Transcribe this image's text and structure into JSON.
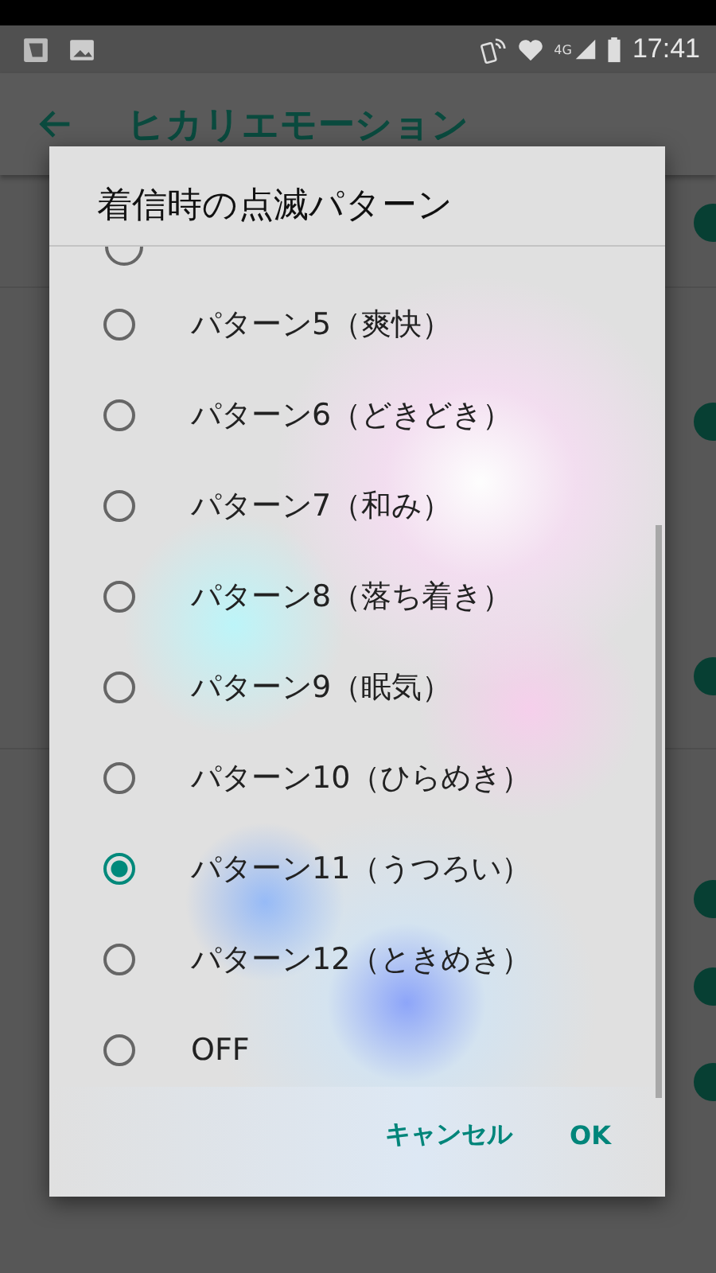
{
  "status_bar": {
    "network_type": "4G",
    "time": "17:41"
  },
  "app_bar": {
    "title": "ヒカリエモーション"
  },
  "background_toggles": [
    {
      "on": true
    },
    {
      "on": true
    },
    {
      "on": true
    },
    {
      "on": true
    },
    {
      "on": true
    },
    {
      "on": true
    }
  ],
  "dialog": {
    "title": "着信時の点滅パターン",
    "cut_option": {
      "selected": false
    },
    "options": [
      {
        "label": "パターン5（爽快）",
        "selected": false
      },
      {
        "label": "パターン6（どきどき）",
        "selected": false
      },
      {
        "label": "パターン7（和み）",
        "selected": false
      },
      {
        "label": "パターン8（落ち着き）",
        "selected": false
      },
      {
        "label": "パターン9（眠気）",
        "selected": false
      },
      {
        "label": "パターン10（ひらめき）",
        "selected": false
      },
      {
        "label": "パターン11（うつろい）",
        "selected": true
      },
      {
        "label": "パターン12（ときめき）",
        "selected": false
      },
      {
        "label": "OFF",
        "selected": false
      }
    ],
    "buttons": [
      "キャンセル",
      "OK"
    ]
  }
}
